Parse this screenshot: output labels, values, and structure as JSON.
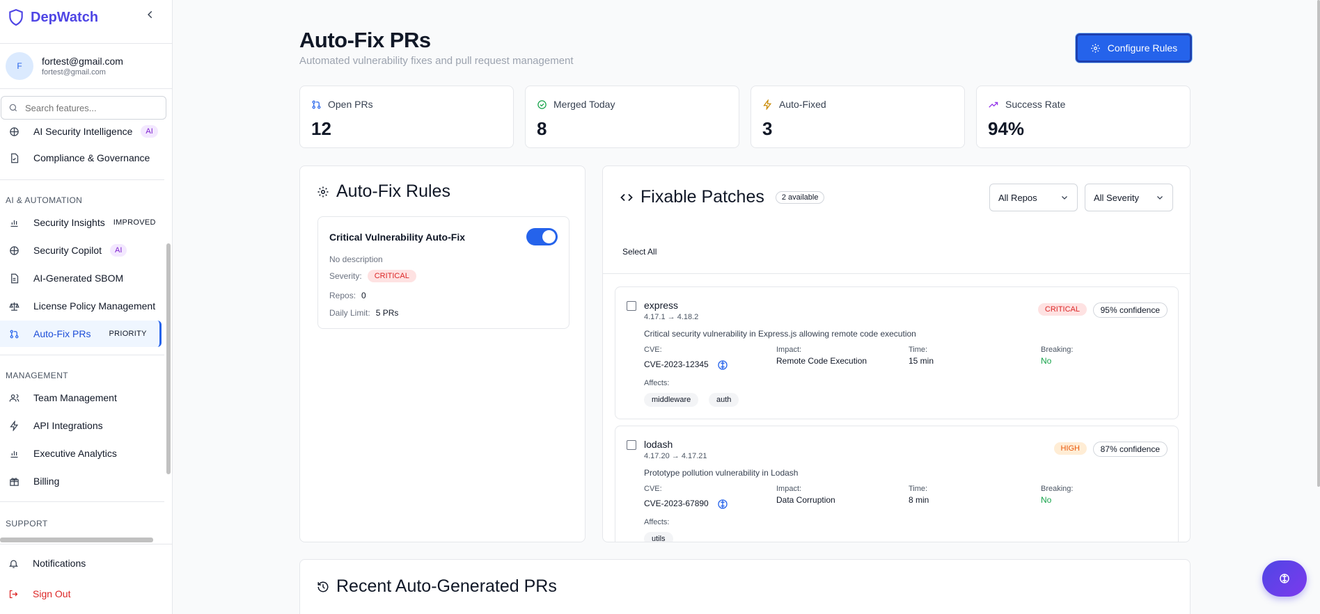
{
  "app": {
    "name": "DepWatch"
  },
  "user": {
    "initial": "F",
    "email": "fortest@gmail.com",
    "sub": "fortest@gmail.com"
  },
  "search": {
    "placeholder": "Search features..."
  },
  "nav": {
    "top_items": [
      {
        "label": "AI Security Intelligence",
        "badge": "AI"
      },
      {
        "label": "Compliance & Governance"
      }
    ],
    "section_ai": "AI & AUTOMATION",
    "ai_items": [
      {
        "label": "Security Insights",
        "badge": "IMPROVED"
      },
      {
        "label": "Security Copilot",
        "badge": "AI"
      },
      {
        "label": "AI-Generated SBOM"
      },
      {
        "label": "License Policy Management"
      },
      {
        "label": "Auto-Fix PRs",
        "badge": "PRIORITY"
      }
    ],
    "section_mgmt": "MANAGEMENT",
    "mgmt_items": [
      {
        "label": "Team Management"
      },
      {
        "label": "API Integrations"
      },
      {
        "label": "Executive Analytics"
      },
      {
        "label": "Billing"
      }
    ],
    "section_support": "SUPPORT",
    "bottom_items": [
      {
        "label": "Notifications"
      },
      {
        "label": "Sign Out"
      }
    ]
  },
  "page": {
    "title": "Auto-Fix PRs",
    "subtitle": "Automated vulnerability fixes and pull request management",
    "configure_label": "Configure Rules"
  },
  "stats": [
    {
      "label": "Open PRs",
      "value": "12"
    },
    {
      "label": "Merged Today",
      "value": "8"
    },
    {
      "label": "Auto-Fixed",
      "value": "3"
    },
    {
      "label": "Success Rate",
      "value": "94%"
    }
  ],
  "rules": {
    "title": "Auto-Fix Rules",
    "items": [
      {
        "name": "Critical Vulnerability Auto-Fix",
        "enabled": true,
        "description": "No description",
        "severity_label": "Severity:",
        "severity": "CRITICAL",
        "repos_label": "Repos:",
        "repos": "0",
        "limit_label": "Daily Limit:",
        "limit": "5 PRs"
      }
    ]
  },
  "patches": {
    "title": "Fixable Patches",
    "count": "2 available",
    "filter_repo": "All Repos",
    "filter_severity": "All Severity",
    "select_all": "Select All",
    "labels": {
      "cve": "CVE:",
      "impact": "Impact:",
      "time": "Time:",
      "breaking": "Breaking:",
      "affects": "Affects:"
    },
    "items": [
      {
        "name": "express",
        "version": "4.17.1 → 4.18.2",
        "severity": "CRITICAL",
        "confidence": "95% confidence",
        "description": "Critical security vulnerability in Express.js allowing remote code execution",
        "cve": "CVE-2023-12345",
        "impact": "Remote Code Execution",
        "time": "15 min",
        "breaking": "No",
        "affects": [
          "middleware",
          "auth"
        ]
      },
      {
        "name": "lodash",
        "version": "4.17.20 → 4.17.21",
        "severity": "HIGH",
        "confidence": "87% confidence",
        "description": "Prototype pollution vulnerability in Lodash",
        "cve": "CVE-2023-67890",
        "impact": "Data Corruption",
        "time": "8 min",
        "breaking": "No",
        "affects": [
          "utils"
        ]
      }
    ]
  },
  "recent": {
    "title": "Recent Auto-Generated PRs"
  },
  "colors": {
    "accent": "#2563eb",
    "brand": "#4f46e5",
    "critical": "#dc2626",
    "high": "#ea580c",
    "success": "#16a34a"
  }
}
